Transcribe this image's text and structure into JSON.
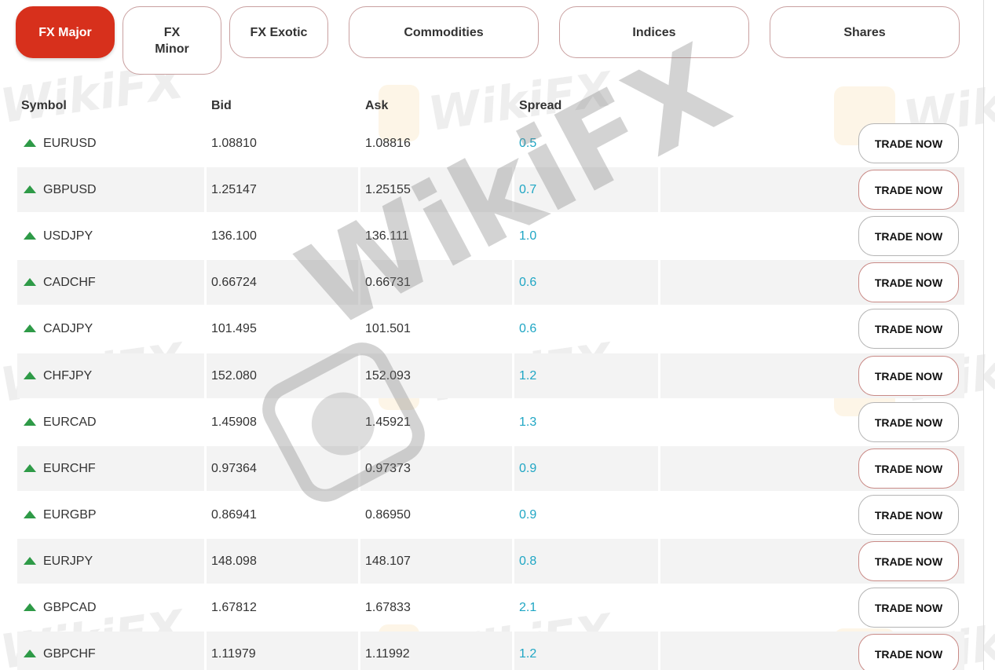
{
  "tabs": [
    {
      "label": "FX Major",
      "active": true
    },
    {
      "label": "FX Minor",
      "line1": "FX",
      "line2": "Minor",
      "active": false
    },
    {
      "label": "FX Exotic",
      "active": false
    },
    {
      "label": "Commodities",
      "active": false
    },
    {
      "label": "Indices",
      "active": false
    },
    {
      "label": "Shares",
      "active": false
    }
  ],
  "table": {
    "headers": {
      "symbol": "Symbol",
      "bid": "Bid",
      "ask": "Ask",
      "spread": "Spread"
    },
    "trade_label": "TRADE NOW",
    "rows": [
      {
        "symbol": "EURUSD",
        "bid": "1.08810",
        "ask": "1.08816",
        "spread": "0.5",
        "trend": "up"
      },
      {
        "symbol": "GBPUSD",
        "bid": "1.25147",
        "ask": "1.25155",
        "spread": "0.7",
        "trend": "up"
      },
      {
        "symbol": "USDJPY",
        "bid": "136.100",
        "ask": "136.111",
        "spread": "1.0",
        "trend": "up"
      },
      {
        "symbol": "CADCHF",
        "bid": "0.66724",
        "ask": "0.66731",
        "spread": "0.6",
        "trend": "up"
      },
      {
        "symbol": "CADJPY",
        "bid": "101.495",
        "ask": "101.501",
        "spread": "0.6",
        "trend": "up"
      },
      {
        "symbol": "CHFJPY",
        "bid": "152.080",
        "ask": "152.093",
        "spread": "1.2",
        "trend": "up"
      },
      {
        "symbol": "EURCAD",
        "bid": "1.45908",
        "ask": "1.45921",
        "spread": "1.3",
        "trend": "up"
      },
      {
        "symbol": "EURCHF",
        "bid": "0.97364",
        "ask": "0.97373",
        "spread": "0.9",
        "trend": "up"
      },
      {
        "symbol": "EURGBP",
        "bid": "0.86941",
        "ask": "0.86950",
        "spread": "0.9",
        "trend": "up"
      },
      {
        "symbol": "EURJPY",
        "bid": "148.098",
        "ask": "148.107",
        "spread": "0.8",
        "trend": "up"
      },
      {
        "symbol": "GBPCAD",
        "bid": "1.67812",
        "ask": "1.67833",
        "spread": "2.1",
        "trend": "up"
      },
      {
        "symbol": "GBPCHF",
        "bid": "1.11979",
        "ask": "1.11992",
        "spread": "1.2",
        "trend": "up"
      }
    ]
  },
  "watermark": {
    "text": "WikiFX"
  },
  "colors": {
    "accent": "#d7301c",
    "up_arrow": "#2e9a47",
    "spread_text": "#1fa6c4",
    "alt_row_bg": "#f3f3f3"
  },
  "icons": {
    "trend_up": "triangle-up-icon"
  }
}
